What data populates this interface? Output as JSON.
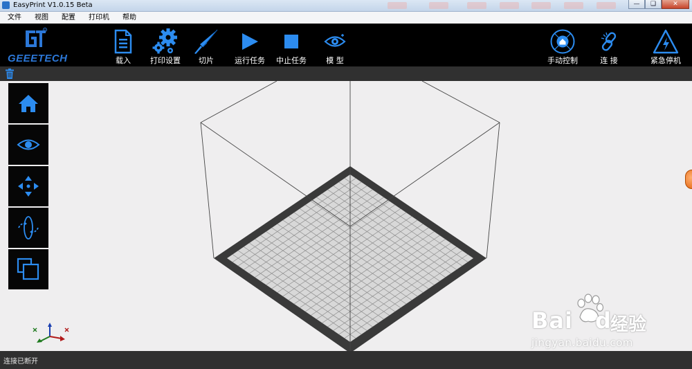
{
  "window": {
    "title": "EasyPrint   V1.0.15 Beta"
  },
  "menubar": {
    "items": [
      "文件",
      "视图",
      "配置",
      "打印机",
      "帮助"
    ]
  },
  "logo": {
    "text": "GEEETECH"
  },
  "toolbar": {
    "load": "载入",
    "print_settings": "打印设置",
    "slice": "切片",
    "run_task": "运行任务",
    "stop_task": "中止任务",
    "model": "模 型",
    "manual_control": "手动控制",
    "connect": "连 接",
    "emergency_stop": "紧急停机"
  },
  "palette": {
    "items": [
      "home-view-icon",
      "eye-view-icon",
      "move-icon",
      "rotate-icon",
      "scale-icon"
    ]
  },
  "watermark": {
    "brand": "Bai",
    "brand2": "du",
    "cn": "经验",
    "sub": "jingyan.baidu.com"
  },
  "status": {
    "text": "连接已断开"
  },
  "colors": {
    "accent": "#2c8cf0",
    "toolbar_bg": "#000000",
    "viewport_bg": "#efeeef",
    "bed_border": "#3a3a3a",
    "bed_fill": "#d8d8d8"
  }
}
